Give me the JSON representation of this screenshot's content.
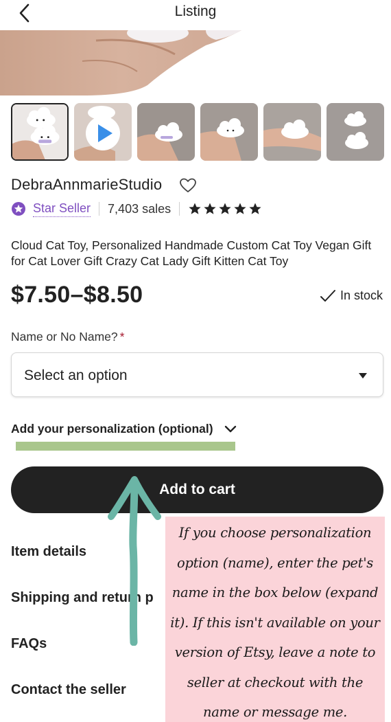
{
  "header": {
    "title": "Listing",
    "back_icon": "back-arrow-icon"
  },
  "gallery": {
    "thumbnails": [
      {
        "kind": "image",
        "selected": true
      },
      {
        "kind": "video",
        "selected": false
      },
      {
        "kind": "image",
        "selected": false
      },
      {
        "kind": "image",
        "selected": false
      },
      {
        "kind": "image",
        "selected": false
      },
      {
        "kind": "image",
        "selected": false
      }
    ]
  },
  "shop": {
    "name": "DebraAnnmarieStudio",
    "badge": "Star Seller",
    "sales": "7,403 sales",
    "rating_stars": 5
  },
  "listing": {
    "title": "Cloud Cat Toy, Personalized Handmade Custom Cat Toy Vegan Gift for Cat Lover Gift Crazy Cat Lady Gift Kitten Cat Toy",
    "price": "$7.50–$8.50",
    "stock": "In stock"
  },
  "variation": {
    "label": "Name or No Name?",
    "required_mark": "*",
    "selected": "Select an option"
  },
  "personalization": {
    "label": "Add your personalization (optional)"
  },
  "cart": {
    "label": "Add to cart"
  },
  "sections": {
    "item_details": "Item details",
    "shipping": "Shipping and return p",
    "faqs": "FAQs",
    "contact": "Contact the seller"
  },
  "annotation": {
    "note": "If you choose personalization option (name), enter the pet's name in the box below (expand it). If this isn't available on your version of Etsy, leave a note to seller at checkout with the name or message me."
  },
  "colors": {
    "star_seller": "#7f4fc0",
    "button_bg": "#222222",
    "highlight": "#a9c68c",
    "arrow": "#6bb5a6",
    "note_bg": "#fbd4d9",
    "required": "#a61a2e"
  }
}
